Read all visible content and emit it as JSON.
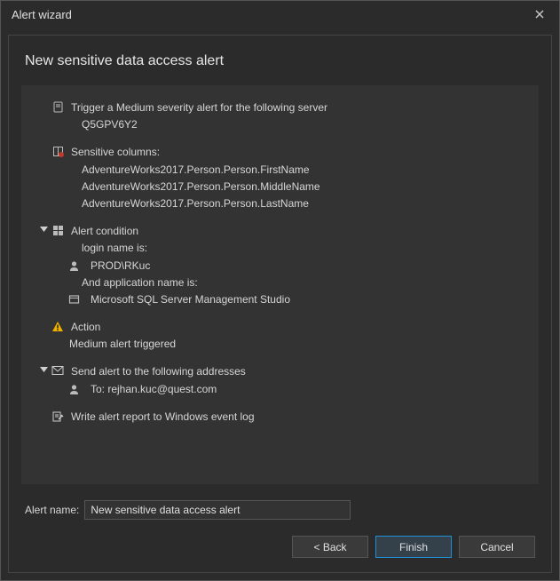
{
  "window": {
    "title": "Alert wizard"
  },
  "heading": "New sensitive data access alert",
  "trigger": {
    "label": "Trigger a Medium severity alert for the following server",
    "server": "Q5GPV6Y2"
  },
  "sensitive_columns": {
    "label": "Sensitive columns:",
    "items": [
      "AdventureWorks2017.Person.Person.FirstName",
      "AdventureWorks2017.Person.Person.MiddleName",
      "AdventureWorks2017.Person.Person.LastName"
    ]
  },
  "alert_condition": {
    "label": "Alert condition",
    "login_label": "login name is:",
    "login_value": "PROD\\RKuc",
    "app_label": "And application name is:",
    "app_value": "Microsoft SQL Server Management Studio"
  },
  "action": {
    "label": "Action",
    "text": "Medium alert triggered"
  },
  "send": {
    "label": "Send alert to the following addresses",
    "to": "To: rejhan.kuc@quest.com"
  },
  "write_log": "Write alert report to Windows event log",
  "alert_name": {
    "label": "Alert name:",
    "value": "New sensitive data access alert"
  },
  "buttons": {
    "back": "< Back",
    "finish": "Finish",
    "cancel": "Cancel"
  }
}
